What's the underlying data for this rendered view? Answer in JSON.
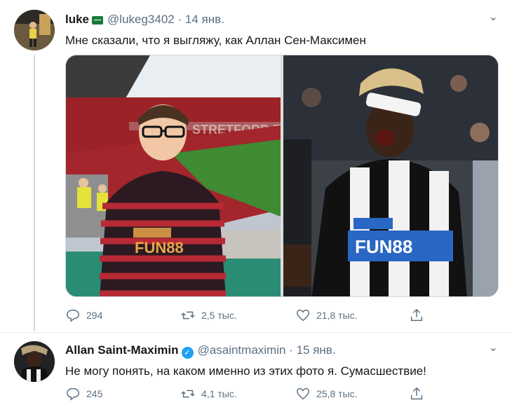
{
  "tweet1": {
    "name": "luke",
    "handle": "@lukeg3402",
    "separator": "·",
    "date": "14 янв.",
    "text": "Мне сказали, что я выгляжу, как Аллан Сен-Максимен",
    "photo_right_shirt_text": "FUN88",
    "photo_left_shirt_text": "FUN88",
    "stands_text": "STRETFORD END",
    "stats": {
      "replies": "294",
      "retweets": "2,5 тыс.",
      "likes": "21,8 тыс."
    }
  },
  "tweet2": {
    "name": "Allan Saint-Maximin",
    "handle": "@asaintmaximin",
    "separator": "·",
    "date": "15 янв.",
    "text": "Не могу понять, на каком именно из этих фото я. Сумасшествие!",
    "stats": {
      "replies": "245",
      "retweets": "4,1 тыс.",
      "likes": "25,8 тыс."
    }
  },
  "icons": [
    "reply-icon",
    "retweet-icon",
    "like-icon",
    "share-icon",
    "caret-down-icon",
    "verified-icon",
    "flag-icon"
  ],
  "colors": {
    "muted": "#5b7083",
    "verified": "#1da1f2",
    "text": "#14171a"
  }
}
